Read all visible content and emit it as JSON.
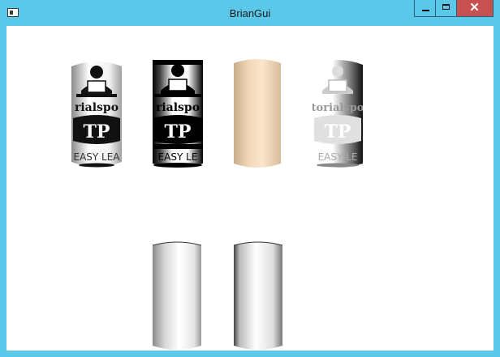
{
  "window": {
    "title": "BrianGui",
    "controls": {
      "minimize_icon": "minimize-icon",
      "maximize_icon": "maximize-icon",
      "close_icon": "close-icon",
      "close_glyph": "✕"
    }
  },
  "cylinders": [
    {
      "name": "logo-cylinder-original",
      "texture": "tutorialspoint-logo",
      "style": "original",
      "label_top": "rialspo",
      "label_mid": "TP",
      "label_bottom": "EASY LEA"
    },
    {
      "name": "logo-cylinder-high-contrast",
      "texture": "tutorialspoint-logo",
      "style": "high-contrast",
      "label_top": "rialspo",
      "label_mid": "TP",
      "label_bottom": "EASY LE"
    },
    {
      "name": "plain-cylinder-peach",
      "texture": "none",
      "style": "solid",
      "color": "#f5dcbf"
    },
    {
      "name": "logo-cylinder-faded",
      "texture": "tutorialspoint-logo",
      "style": "faded",
      "label_top": "torialspo",
      "label_mid": "TP",
      "label_bottom": "EASY LE"
    },
    {
      "name": "plain-cylinder-white-left",
      "texture": "none",
      "style": "shaded",
      "color": "#ffffff"
    },
    {
      "name": "plain-cylinder-white-right",
      "texture": "none",
      "style": "shaded",
      "color": "#ffffff"
    }
  ]
}
